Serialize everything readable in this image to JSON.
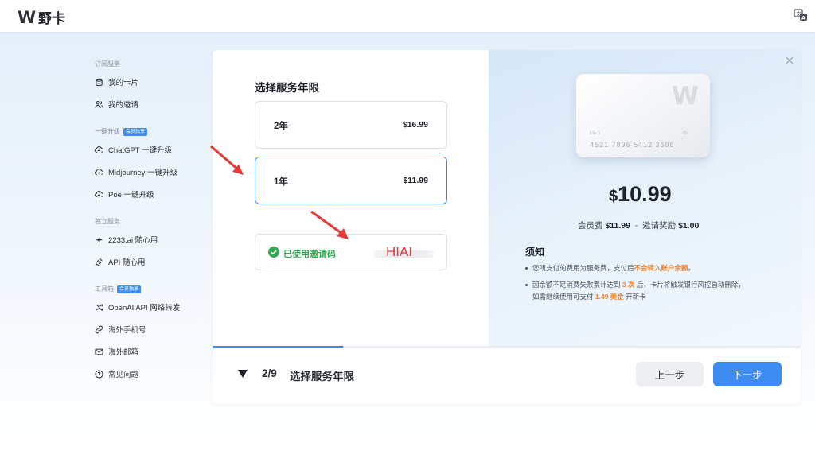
{
  "app": {
    "name": "野卡",
    "logo_letter": "W"
  },
  "sidebar": {
    "sections": [
      {
        "title": "订阅服务",
        "badge": ""
      },
      {
        "title": "一键升级",
        "badge": "会员独享"
      },
      {
        "title": "独立服务",
        "badge": ""
      },
      {
        "title": "工具箱",
        "badge": "会员独享"
      }
    ],
    "items": [
      {
        "label": "我的卡片",
        "icon": "coins-icon"
      },
      {
        "label": "我的邀请",
        "icon": "users-icon"
      },
      {
        "label": "ChatGPT 一键升级",
        "icon": "cloud-upload-icon"
      },
      {
        "label": "Midjourney 一键升级",
        "icon": "cloud-upload-icon"
      },
      {
        "label": "Poe 一键升级",
        "icon": "cloud-upload-icon"
      },
      {
        "label": "2233.ai 随心用",
        "icon": "sparkle-icon"
      },
      {
        "label": "API 随心用",
        "icon": "plug-icon"
      },
      {
        "label": "OpenAI API 网络转发",
        "icon": "shuffle-icon"
      },
      {
        "label": "海外手机号",
        "icon": "link-icon"
      },
      {
        "label": "海外邮箱",
        "icon": "mail-icon"
      },
      {
        "label": "常见问题",
        "icon": "help-circle-icon"
      }
    ]
  },
  "plan": {
    "title": "选择服务年限",
    "options": [
      {
        "label": "2年",
        "price": "$16.99",
        "selected": false
      },
      {
        "label": "1年",
        "price": "$11.99",
        "selected": true
      }
    ],
    "invite": {
      "status": "已使用邀请码",
      "code": "HIAI"
    }
  },
  "card_preview": {
    "logo": "W",
    "holder": "Elle Ji",
    "expiry": "/25",
    "number": "4521  7896  5412  3698"
  },
  "summary": {
    "currency": "$",
    "total": "10.99",
    "fee_label": "会员费",
    "fee": "$11.99",
    "separator": "-",
    "reward_label": "邀请奖励",
    "reward": "$1.00"
  },
  "notice": {
    "title": "须知",
    "item1_a": "您所支付的费用为服务费，支付后",
    "item1_hl": "不会转入账户余额",
    "item1_b": "。",
    "item2_a": "因余额不足消费失败累计达到",
    "item2_hl": "3 次",
    "item2_b": "后，卡片将触发银行风控自动删除，",
    "item2_c": "如需继续使用可支付",
    "item2_hl2": "1.49 美金",
    "item2_d": "开新卡"
  },
  "progress": {
    "current_step": 2,
    "total_steps": 9,
    "fraction": 0.222
  },
  "footer": {
    "step": "2/9",
    "step_name": "选择服务年限",
    "prev_label": "上一步",
    "next_label": "下一步"
  },
  "colors": {
    "accent": "#3f8cf0",
    "success": "#33a854",
    "highlight": "#f0822c",
    "annotation": "#e53935"
  }
}
